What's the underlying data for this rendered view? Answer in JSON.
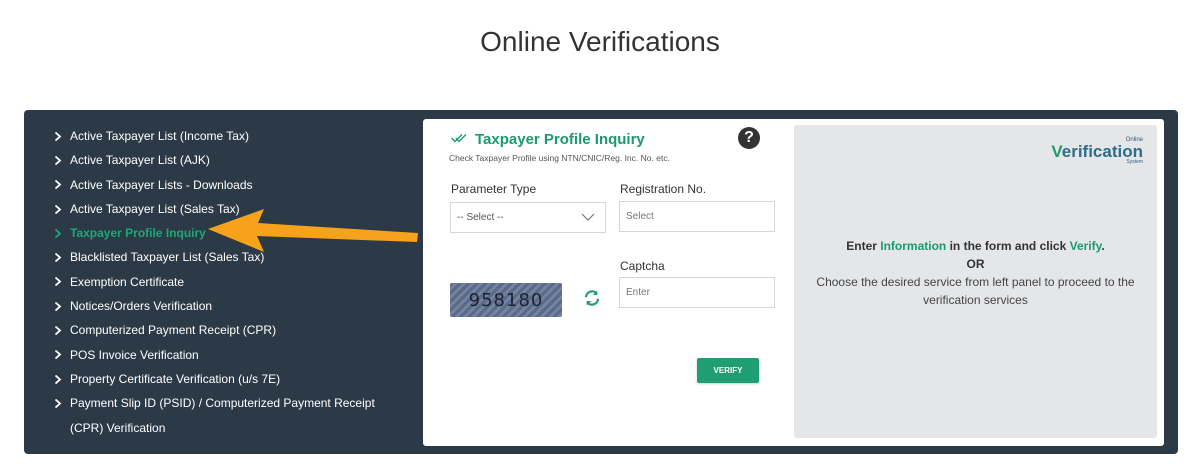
{
  "page": {
    "title": "Online Verifications"
  },
  "sidebar": {
    "items": [
      {
        "label": "Active Taxpayer List (Income Tax)"
      },
      {
        "label": "Active Taxpayer List (AJK)"
      },
      {
        "label": "Active Taxpayer Lists - Downloads"
      },
      {
        "label": "Active Taxpayer List (Sales Tax)"
      },
      {
        "label": "Taxpayer Profile Inquiry",
        "active": true
      },
      {
        "label": "Blacklisted Taxpayer List (Sales Tax)"
      },
      {
        "label": "Exemption Certificate"
      },
      {
        "label": "Notices/Orders Verification"
      },
      {
        "label": "Computerized Payment Receipt (CPR)"
      },
      {
        "label": "POS Invoice Verification"
      },
      {
        "label": "Property Certificate Verification (u/s 7E)"
      },
      {
        "label": "Payment Slip ID (PSID) / Computerized Payment Receipt (CPR) Verification"
      }
    ],
    "active_color": "#1ea67a"
  },
  "form": {
    "title": "Taxpayer Profile Inquiry",
    "subtitle": "Check Taxpayer Profile using NTN/CNIC/Reg. Inc. No. etc.",
    "help_glyph": "?",
    "parameter_type_label": "Parameter Type",
    "parameter_type_value": "-- Select --",
    "registration_label": "Registration No.",
    "registration_placeholder": "Select",
    "captcha_label": "Captcha",
    "captcha_placeholder": "Enter",
    "captcha_code": "958180",
    "verify_label": "VERIFY",
    "accent_color": "#1e9e72"
  },
  "info": {
    "logo_small": "Online",
    "logo_big_v": "V",
    "logo_big_rest": "erification",
    "logo_system": "System",
    "line1_prefix": "Enter ",
    "line1_info": "Information",
    "line1_mid": " in the form and click ",
    "line1_verify": "Verify",
    "line1_suffix": ".",
    "line2": "OR",
    "line3": "Choose the desired service from left panel to proceed to the verification services"
  },
  "icons": {
    "chevron": "chevron-right-icon",
    "check": "double-check-icon",
    "help": "question-circle-icon",
    "caret": "chevron-down-icon",
    "refresh": "refresh-icon",
    "arrow": "pointer-arrow-icon"
  },
  "colors": {
    "panel_bg": "#2c3a47",
    "arrow": "#f7a21b"
  }
}
